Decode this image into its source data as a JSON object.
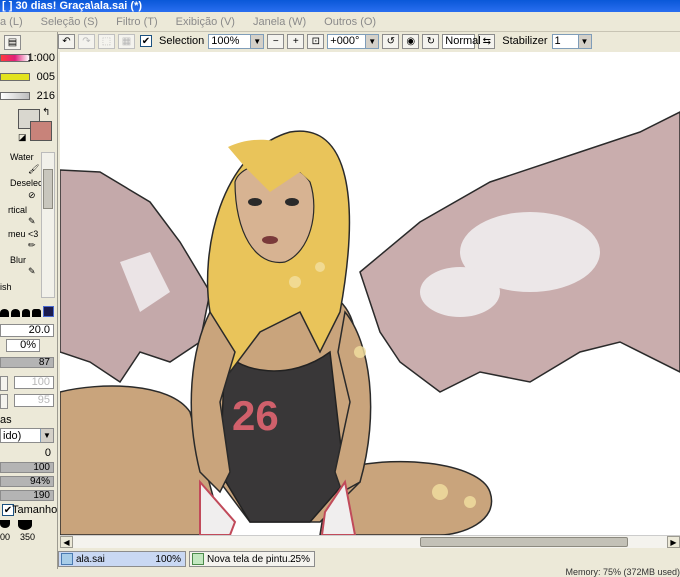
{
  "window": {
    "title": "[ ] 30 dias! Graça\\ala.sai (*)"
  },
  "menu": [
    {
      "label": "a (L)"
    },
    {
      "label": "Seleção (S)"
    },
    {
      "label": "Filtro (T)"
    },
    {
      "label": "Exibição (V)"
    },
    {
      "label": "Janela (W)"
    },
    {
      "label": "Outros (O)"
    }
  ],
  "toolbar": {
    "selection_label": "Selection",
    "selection_checked": true,
    "zoom": "100%",
    "rotation": "+000°",
    "blend_mode": "Normal",
    "stabilizer_label": "Stabilizer",
    "stabilizer_value": "1"
  },
  "left_panel": {
    "color_sliders": [
      {
        "value": "1:000",
        "color": "#e0207a"
      },
      {
        "value": "005",
        "color": "#e3e31c"
      },
      {
        "value": "216",
        "color": "#dddddd"
      }
    ],
    "primary_color": "#d9d7cf",
    "secondary_color": "#c8837a",
    "tools": [
      {
        "label": "Water"
      },
      {
        "label": "Deselect"
      },
      {
        "label": "rtical"
      },
      {
        "label": "meu <3"
      },
      {
        "label": "Blur"
      },
      {
        "label": "ish"
      }
    ],
    "brush_size": "20.0",
    "min_size": "0%",
    "density": "87",
    "disabled_value_1": "100",
    "disabled_value_2": "95",
    "section_label": "as",
    "mode_select": "ido)",
    "value_0": "0",
    "value_100": "100",
    "value_94": "94%",
    "value_190": "190",
    "size_checkbox_label": "Tamanho",
    "size_checked": true,
    "brush_preset_values": [
      "00",
      "350"
    ]
  },
  "document_tabs": [
    {
      "name": "ala.sai",
      "percent": "100%",
      "active": true
    },
    {
      "name": "Nova tela de pintu...",
      "percent": "25%",
      "active": false
    }
  ],
  "status": {
    "memory": "Memory: 75% (372MB used)"
  }
}
